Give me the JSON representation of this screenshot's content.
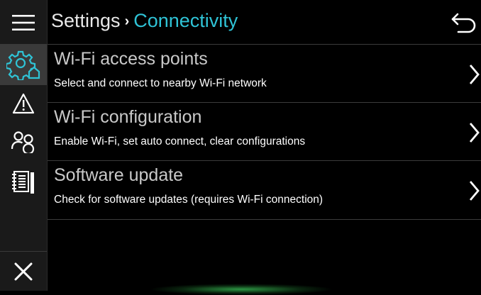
{
  "header": {
    "breadcrumb_root": "Settings",
    "breadcrumb_separator": "›",
    "breadcrumb_current": "Connectivity",
    "accent_color": "#2fc3d6"
  },
  "sidebar": {
    "items": [
      {
        "icon": "menu-icon"
      },
      {
        "icon": "settings-home-icon",
        "active": true
      },
      {
        "icon": "warning-icon"
      },
      {
        "icon": "users-icon"
      },
      {
        "icon": "logbook-icon"
      },
      {
        "icon": "close-icon"
      }
    ]
  },
  "menu": {
    "items": [
      {
        "title": "Wi-Fi access points",
        "description": "Select and connect to nearby Wi-Fi network"
      },
      {
        "title": "Wi-Fi configuration",
        "description": "Enable Wi-Fi, set auto connect, clear configurations"
      },
      {
        "title": "Software update",
        "description": "Check for software updates (requires Wi-Fi connection)"
      }
    ]
  }
}
